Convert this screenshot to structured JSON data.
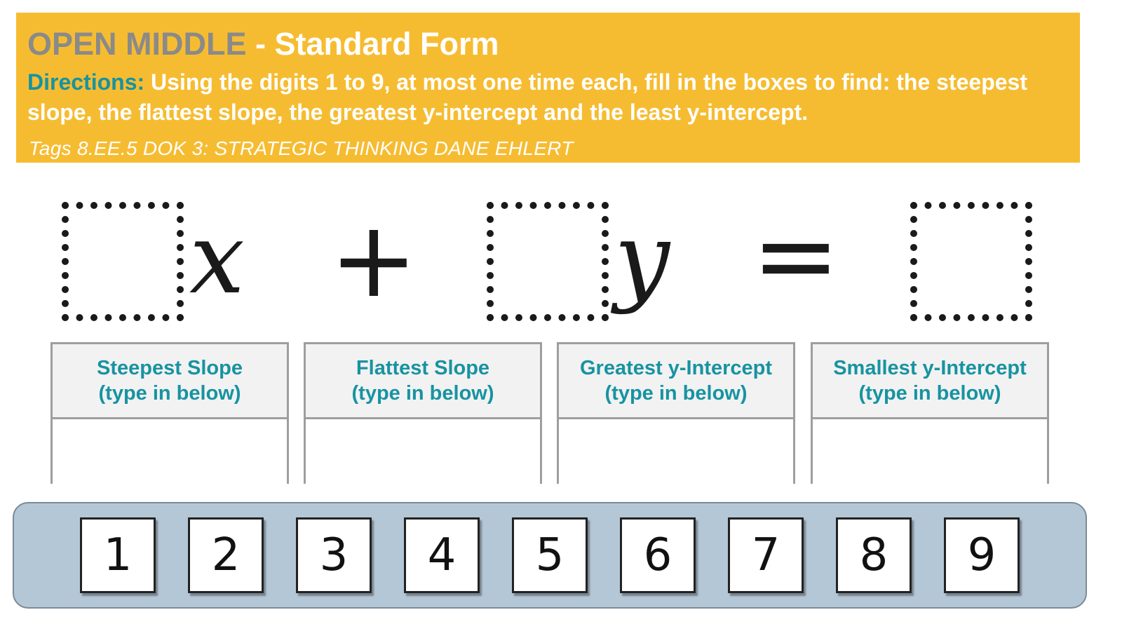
{
  "header": {
    "title_prefix": "OPEN MIDDLE",
    "title_suffix": " - Standard Form",
    "directions_label": "Directions:",
    "directions_text": " Using the digits 1 to 9, at most one time each, fill in the boxes to find: the steepest slope, the flattest slope, the greatest y-intercept and the least y-intercept.",
    "tags": "Tags 8.EE.5 DOK 3: STRATEGIC THINKING  DANE EHLERT"
  },
  "equation": {
    "var_x": "x",
    "plus": "+",
    "var_y": "y",
    "equals": "="
  },
  "answers": [
    {
      "title": "Steepest Slope",
      "hint": "(type in below)",
      "value": ""
    },
    {
      "title": "Flattest Slope",
      "hint": "(type in below)",
      "value": ""
    },
    {
      "title": "Greatest y-Intercept",
      "hint": "(type in below)",
      "value": ""
    },
    {
      "title": "Smallest y-Intercept",
      "hint": "(type in below)",
      "value": ""
    }
  ],
  "digits": [
    "1",
    "2",
    "3",
    "4",
    "5",
    "6",
    "7",
    "8",
    "9"
  ],
  "colors": {
    "banner": "#f6bc31",
    "accent_teal": "#1793a1",
    "title_gray": "#8a8a8a",
    "tray": "#b4c7d6"
  }
}
